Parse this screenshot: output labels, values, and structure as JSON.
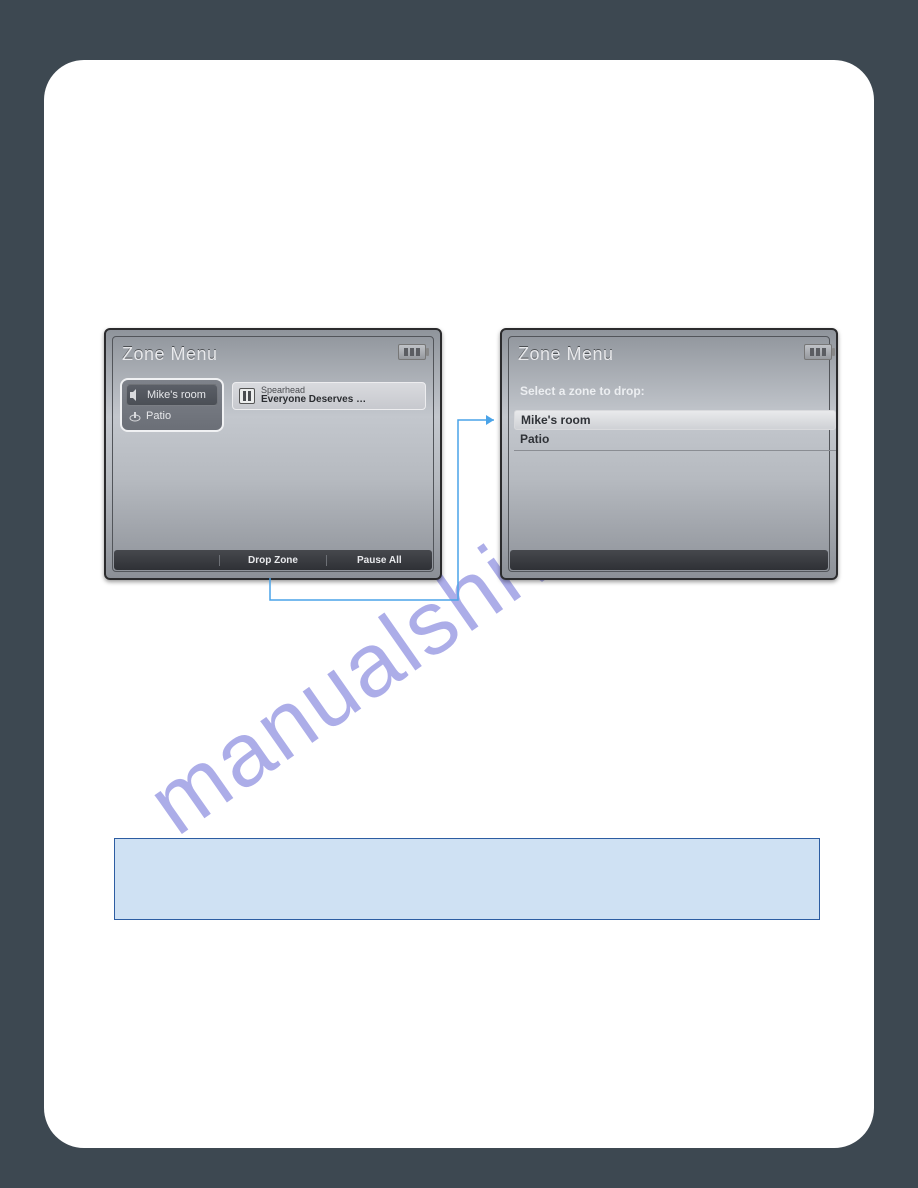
{
  "watermark": "manualshive.com",
  "left_device": {
    "title": "Zone Menu",
    "zones": [
      {
        "label": "Mike's room",
        "selected": true
      },
      {
        "label": "Patio",
        "selected": false
      }
    ],
    "track": {
      "artist": "Spearhead",
      "song": "Everyone Deserves …"
    },
    "softkeys": [
      "",
      "Drop Zone",
      "Pause All"
    ]
  },
  "right_device": {
    "title": "Zone Menu",
    "subheading": "Select a zone to drop:",
    "items": [
      {
        "label": "Mike's room",
        "selected": true
      },
      {
        "label": "Patio",
        "selected": false
      }
    ],
    "softkeys": [
      "",
      "",
      ""
    ]
  }
}
